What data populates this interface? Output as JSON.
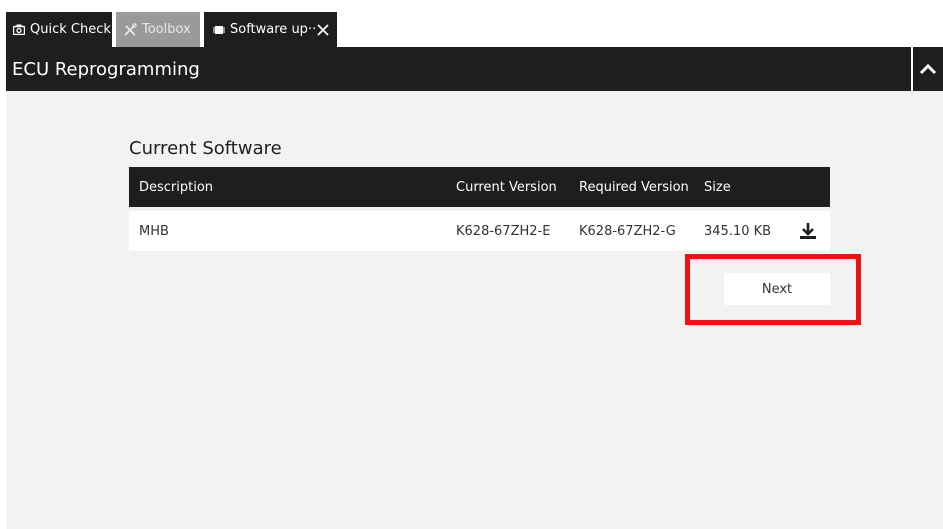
{
  "tabs": [
    {
      "label": "Quick Check",
      "icon": "camera-icon"
    },
    {
      "label": "Toolbox",
      "icon": "tools-icon"
    },
    {
      "label": "Software up··",
      "icon": "chip-icon"
    }
  ],
  "header": {
    "title": "ECU Reprogramming"
  },
  "section": {
    "title": "Current Software"
  },
  "table": {
    "columns": [
      "Description",
      "Current Version",
      "Required Version",
      "Size"
    ],
    "rows": [
      {
        "description": "MHB",
        "current_version": "K628-67ZH2-E",
        "required_version": "K628-67ZH2-G",
        "size": "345.10 KB"
      }
    ]
  },
  "actions": {
    "next_label": "Next"
  },
  "colors": {
    "dark": "#1e1e1e",
    "inactive_tab": "#9a9a9a",
    "content_bg": "#f2f2f2",
    "highlight": "#ee1111"
  }
}
